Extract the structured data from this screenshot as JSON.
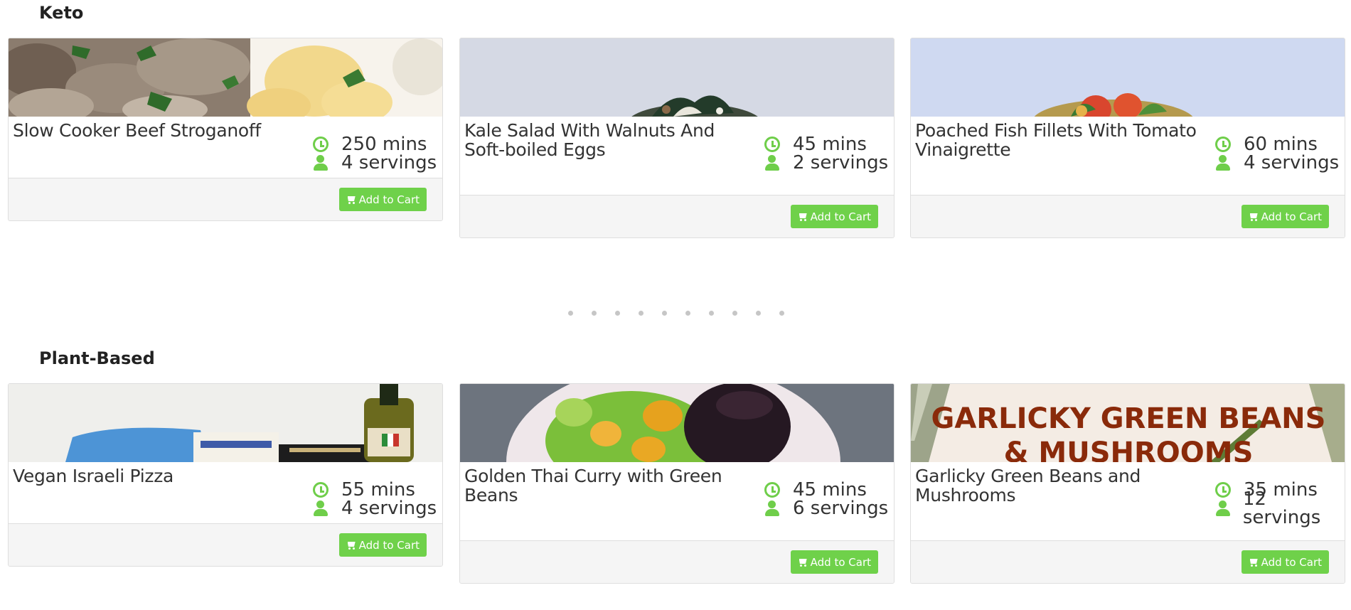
{
  "sections": [
    {
      "title": "Keto",
      "recipes": [
        {
          "title": "Slow Cooker Beef Stroganoff",
          "time": "250 mins",
          "servings": "4 servings",
          "button": "Add to Cart",
          "image": "beef-stroganoff-photo"
        },
        {
          "title": "Kale Salad With Walnuts And Soft-boiled Eggs",
          "time": "45 mins",
          "servings": "2 servings",
          "button": "Add to Cart",
          "image": "kale-salad-photo"
        },
        {
          "title": "Poached Fish Fillets With Tomato Vinaigrette",
          "time": "60 mins",
          "servings": "4 servings",
          "button": "Add to Cart",
          "image": "poached-fish-photo"
        }
      ]
    },
    {
      "title": "Plant-Based",
      "recipes": [
        {
          "title": "Vegan Israeli Pizza",
          "time": "55 mins",
          "servings": "4 servings",
          "button": "Add to Cart",
          "image": "pizza-ingredients-photo"
        },
        {
          "title": "Golden Thai Curry with Green Beans",
          "time": "45 mins",
          "servings": "6 servings",
          "button": "Add to Cart",
          "image": "thai-curry-photo"
        },
        {
          "title": "Garlicky Green Beans and Mushrooms",
          "time": "35 mins",
          "servings": "12 servings",
          "button": "Add to Cart",
          "image": "green-beans-photo",
          "image_text_1": "GARLICKY GREEN BEANS",
          "image_text_2": "& MUSHROOMS"
        }
      ]
    }
  ],
  "carousel": {
    "dot_count": 10
  },
  "colors": {
    "accent": "#6fd14a",
    "icon": "#6fce4a",
    "footer_bg": "#f5f5f5"
  },
  "icons": {
    "time": "clock-icon",
    "servings": "user-icon",
    "cart": "shopping-cart-icon"
  }
}
